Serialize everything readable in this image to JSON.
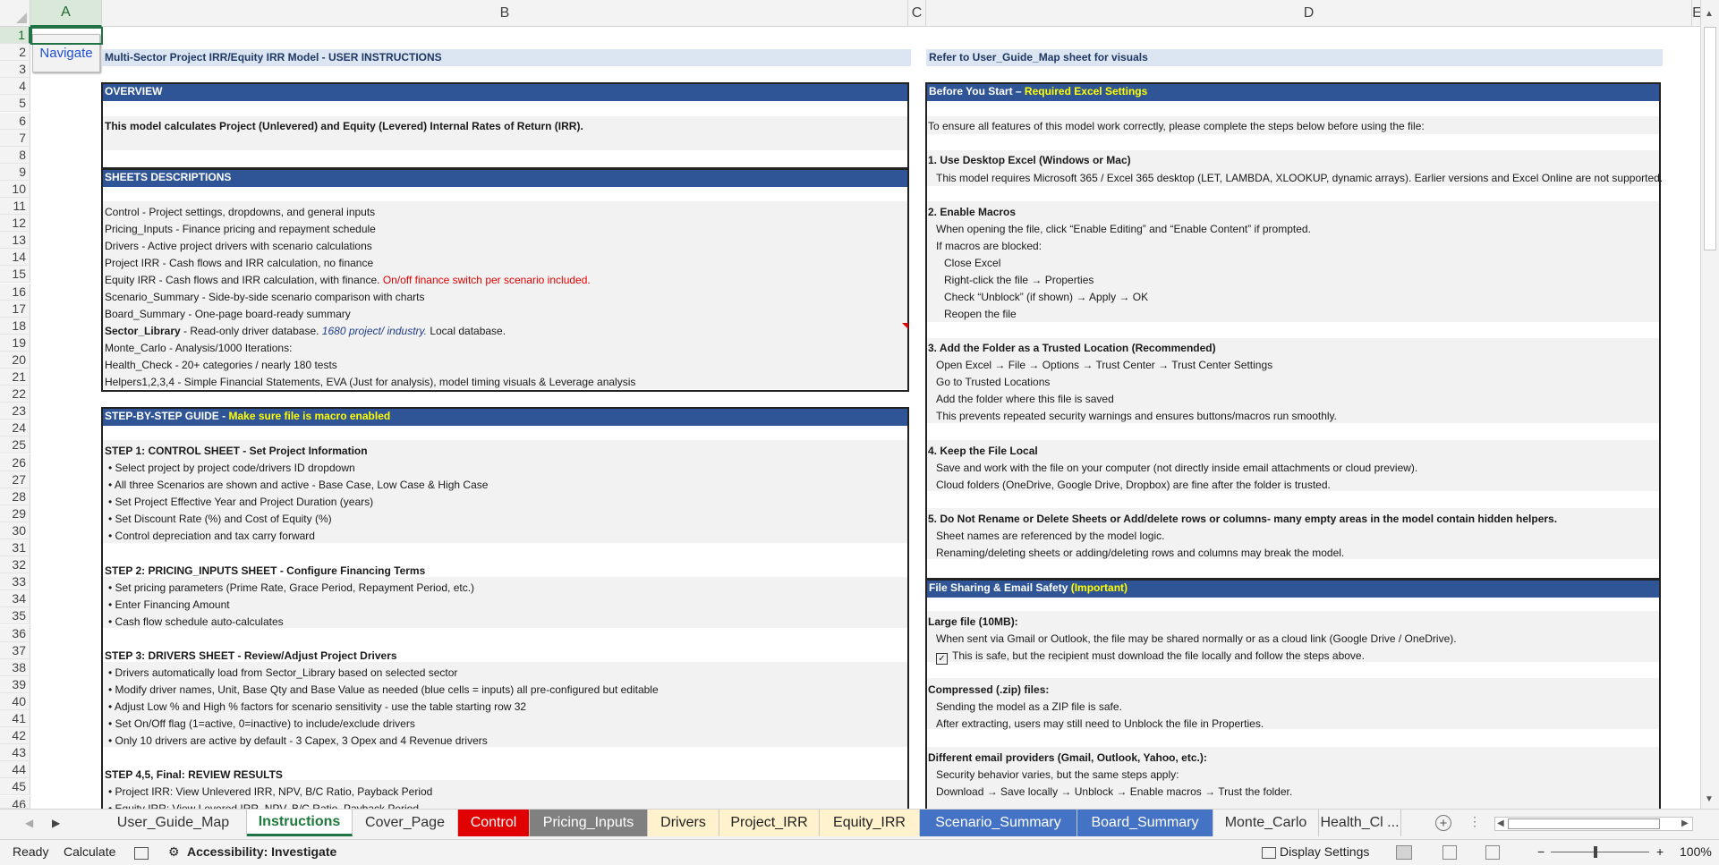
{
  "columns": [
    "A",
    "B",
    "C",
    "D",
    "E"
  ],
  "rows": [
    "1",
    "2",
    "3",
    "4",
    "5",
    "6",
    "7",
    "8",
    "9",
    "10",
    "11",
    "12",
    "13",
    "14",
    "15",
    "16",
    "17",
    "18",
    "19",
    "20",
    "21",
    "22",
    "23",
    "24",
    "25",
    "26",
    "27",
    "28",
    "29",
    "30",
    "31",
    "32",
    "33",
    "34",
    "35",
    "36",
    "37",
    "38",
    "39",
    "40",
    "41",
    "42",
    "43",
    "44",
    "45",
    "46"
  ],
  "navigate_button": "Navigate",
  "title_left": "Multi-Sector Project IRR/Equity IRR Model - USER INSTRUCTIONS",
  "title_right": "Refer to User_Guide_Map sheet for visuals",
  "overview": {
    "header": "OVERVIEW",
    "text": "This model calculates Project (Unlevered) and Equity (Levered) Internal Rates of Return (IRR)."
  },
  "sheets": {
    "header": "SHEETS DESCRIPTIONS",
    "lines": [
      "Control - Project settings, dropdowns, and general inputs",
      "Pricing_Inputs - Finance pricing and repayment schedule",
      "Drivers - Active project drivers with scenario calculations",
      "Project IRR - Cash flows and IRR calculation, no finance"
    ],
    "equity_prefix": "Equity IRR - Cash flows and IRR calculation, with finance.",
    "equity_red": "On/off finance switch per scenario included.",
    "lines2": [
      "Scenario_Summary - Side-by-side scenario comparison with charts",
      "Board_Summary - One-page board-ready summary"
    ],
    "sector_bold": "Sector_Library",
    "sector_text": " - Read-only driver database. ",
    "sector_italic": "1680 project/ industry.",
    "sector_tail": "  Local database.",
    "lines3": [
      "Monte_Carlo - Analysis/1000 Iterations:",
      "Health_Check - 20+ categories / nearly 180 tests",
      "Helpers1,2,3,4 - Simple Financial Statements, EVA (Just for analysis), model timing visuals & Leverage analysis"
    ]
  },
  "guide": {
    "header": "STEP-BY-STEP GUIDE - ",
    "header_hl": "Make sure file is macro enabled",
    "step1": "STEP 1: CONTROL SHEET - Set Project Information",
    "step1_items": [
      "• Select project by project code/drivers ID dropdown",
      "• All three Scenarios are shown and active - Base Case, Low Case & High Case",
      "• Set Project Effective Year and Project Duration (years)",
      "• Set Discount Rate (%) and Cost of Equity (%)",
      "• Control depreciation and tax carry forward"
    ],
    "step2": "STEP 2: PRICING_INPUTS SHEET - Configure Financing Terms",
    "step2_items": [
      "• Set pricing parameters (Prime Rate, Grace Period, Repayment Period, etc.)",
      "• Enter Financing Amount",
      "• Cash flow schedule auto-calculates"
    ],
    "step3": "STEP 3: DRIVERS SHEET - Review/Adjust Project Drivers",
    "step3_items": [
      "• Drivers automatically load from Sector_Library based on selected sector",
      "• Modify driver names, Unit, Base Qty and Base Value as needed (blue cells = inputs) all pre-configured but editable",
      "• Adjust Low % and High % factors for scenario sensitivity - use the table starting row 32",
      "• Set On/Off flag (1=active, 0=inactive) to include/exclude drivers",
      "• Only  10 drivers are active by default - 3 Capex, 3 Opex and 4 Revenue drivers"
    ],
    "step45": "STEP 4,5, Final: REVIEW RESULTS",
    "step45_items": [
      "• Project IRR: View Unlevered IRR, NPV, B/C Ratio, Payback Period",
      "• Equity IRR: View Levered IRR, NPV, B/C Ratio, Payback Period"
    ]
  },
  "before": {
    "header": "Before You Start – ",
    "header_hl": "Required Excel Settings",
    "intro": "To ensure all features of this model work correctly, please complete the steps below before using the file:",
    "s1": "1. Use Desktop Excel (Windows or Mac)",
    "s1_items": [
      "This model requires Microsoft 365 / Excel 365 desktop (LET, LAMBDA, XLOOKUP, dynamic arrays). Earlier versions and Excel Online are not supported."
    ],
    "s2": "2. Enable Macros",
    "s2_items": [
      "When opening the file, click “Enable Editing” and “Enable Content” if prompted.",
      "If macros are blocked:"
    ],
    "s2_sub": [
      "Close Excel",
      "Right-click the file → Properties",
      "Check “Unblock” (if shown) → Apply → OK",
      "Reopen the file"
    ],
    "s3": "3. Add the Folder as a Trusted Location (Recommended)",
    "s3_items": [
      "Open Excel → File → Options → Trust Center → Trust Center Settings",
      "Go to Trusted Locations",
      "Add the folder where this file is saved",
      "This prevents repeated security warnings and ensures buttons/macros run smoothly."
    ],
    "s4": "4. Keep the File Local",
    "s4_items": [
      "Save and work with the file on your computer (not directly inside email attachments or cloud preview).",
      "Cloud folders (OneDrive, Google Drive, Dropbox) are fine after the folder is trusted."
    ],
    "s5": "5. Do Not Rename or Delete Sheets or Add/delete rows or columns- many empty areas in the model contain hidden helpers.",
    "s5_items": [
      "Sheet names are referenced by the model logic.",
      "Renaming/deleting sheets or adding/deleting rows and columns may break the model."
    ]
  },
  "sharing": {
    "header": "File Sharing & Email Safety ",
    "header_hl": "(Important)",
    "large": "Large file (10MB):",
    "large_items": [
      "When sent via Gmail or Outlook, the file may be shared normally or as a cloud link (Google Drive / OneDrive)."
    ],
    "large_check": "This is safe, but the recipient must download the file locally and follow the steps above.",
    "zip": "Compressed (.zip) files:",
    "zip_items": [
      "Sending the model as a ZIP file is safe.",
      "After extracting, users may still need to Unblock the file in Properties."
    ],
    "email": "Different email providers (Gmail, Outlook, Yahoo, etc.):",
    "email_items": [
      "Security behavior varies, but the same steps apply:",
      "Download → Save locally → Unblock → Enable macros → Trust the folder."
    ]
  },
  "tabs": [
    {
      "label": "User_Guide_Map",
      "bg": "#f3f3f3",
      "fg": "#333333"
    },
    {
      "label": "Instructions",
      "bg": "#ffffff",
      "fg": "#1e7a3c"
    },
    {
      "label": "Cover_Page",
      "bg": "#f3f3f3",
      "fg": "#333333"
    },
    {
      "label": "Control",
      "bg": "#e00000",
      "fg": "#ffffff"
    },
    {
      "label": "Pricing_Inputs",
      "bg": "#808080",
      "fg": "#ffffff"
    },
    {
      "label": "Drivers",
      "bg": "#fff2cc",
      "fg": "#222222"
    },
    {
      "label": "Project_IRR",
      "bg": "#fff2cc",
      "fg": "#222222"
    },
    {
      "label": "Equity_IRR",
      "bg": "#fff2cc",
      "fg": "#222222"
    },
    {
      "label": "Scenario_Summary",
      "bg": "#4472c4",
      "fg": "#ffffff"
    },
    {
      "label": "Board_Summary",
      "bg": "#4472c4",
      "fg": "#ffffff"
    },
    {
      "label": "Monte_Carlo",
      "bg": "#f3f3f3",
      "fg": "#333333"
    },
    {
      "label": "Health_Cl ...",
      "bg": "#f3f3f3",
      "fg": "#333333"
    }
  ],
  "status": {
    "ready": "Ready",
    "calculate": "Calculate",
    "accessibility": "Accessibility: Investigate",
    "display_settings": "Display Settings",
    "zoom": "100%"
  },
  "colors": {
    "header_blue": "#2f5597",
    "highlight_yellow": "#ffff00",
    "excel_green": "#217346"
  }
}
